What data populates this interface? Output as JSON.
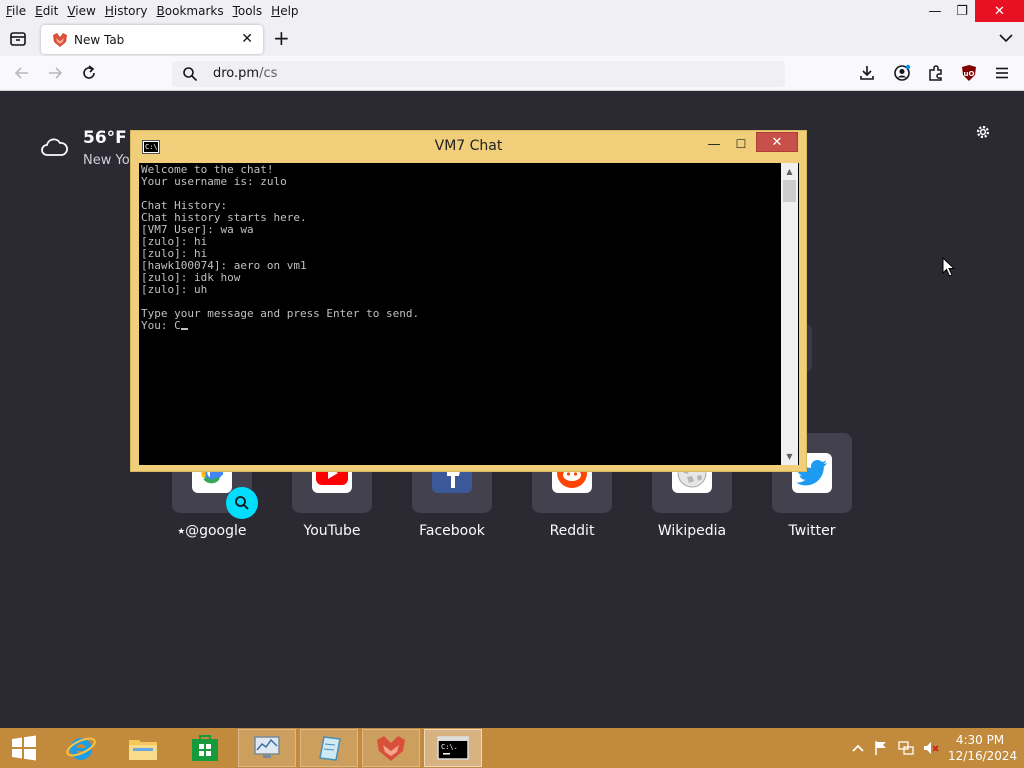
{
  "menubar": {
    "items": [
      "File",
      "Edit",
      "View",
      "History",
      "Bookmarks",
      "Tools",
      "Help"
    ]
  },
  "window_controls": {
    "minimize": "—",
    "restore": "❐",
    "close": "✕"
  },
  "tabs": [
    {
      "title": "New Tab",
      "active": true,
      "favicon": "firefox-fox-icon"
    }
  ],
  "tab_close": "✕",
  "new_tab": "+",
  "urlbar": {
    "host": "dro.pm",
    "path": "/cs"
  },
  "weather": {
    "temp": "56°F",
    "location": "New Yo"
  },
  "shortcuts": [
    {
      "label": "@google",
      "pinned": true,
      "icon": "google-icon"
    },
    {
      "label": "YouTube",
      "icon": "youtube-icon"
    },
    {
      "label": "Facebook",
      "icon": "facebook-icon"
    },
    {
      "label": "Reddit",
      "icon": "reddit-icon"
    },
    {
      "label": "Wikipedia",
      "icon": "wikipedia-icon"
    },
    {
      "label": "Twitter",
      "icon": "twitter-icon"
    }
  ],
  "console": {
    "title": "VM7 Chat",
    "icon_text": "C:\\.",
    "lines": [
      "Welcome to the chat!",
      "Your username is: zulo",
      "",
      "Chat History:",
      "Chat history starts here.",
      "[VM7 User]: wa wa",
      "[zulo]: hi",
      "[zulo]: hi",
      "[hawk100074]: aero on vm1",
      "[zulo]: idk how",
      "[zulo]: uh",
      "",
      "Type your message and press Enter to send."
    ],
    "prompt": "You: ",
    "input_value": "C",
    "controls": {
      "minimize": "—",
      "maximize": "☐",
      "close": "✕"
    }
  },
  "taskbar": {
    "apps": [
      "start-icon",
      "internet-explorer-icon",
      "file-explorer-icon",
      "store-icon",
      "app-icon",
      "app-icon",
      "firefox-icon",
      "cmd-icon"
    ],
    "clock_time": "4:30 PM",
    "clock_date": "12/16/2024"
  },
  "colors": {
    "page_bg": "#2b2a33",
    "taskbar": "#c18a3c",
    "console_frame": "#f1cf7a",
    "console_close": "#c7504a",
    "accent_cyan": "#00ddff"
  }
}
